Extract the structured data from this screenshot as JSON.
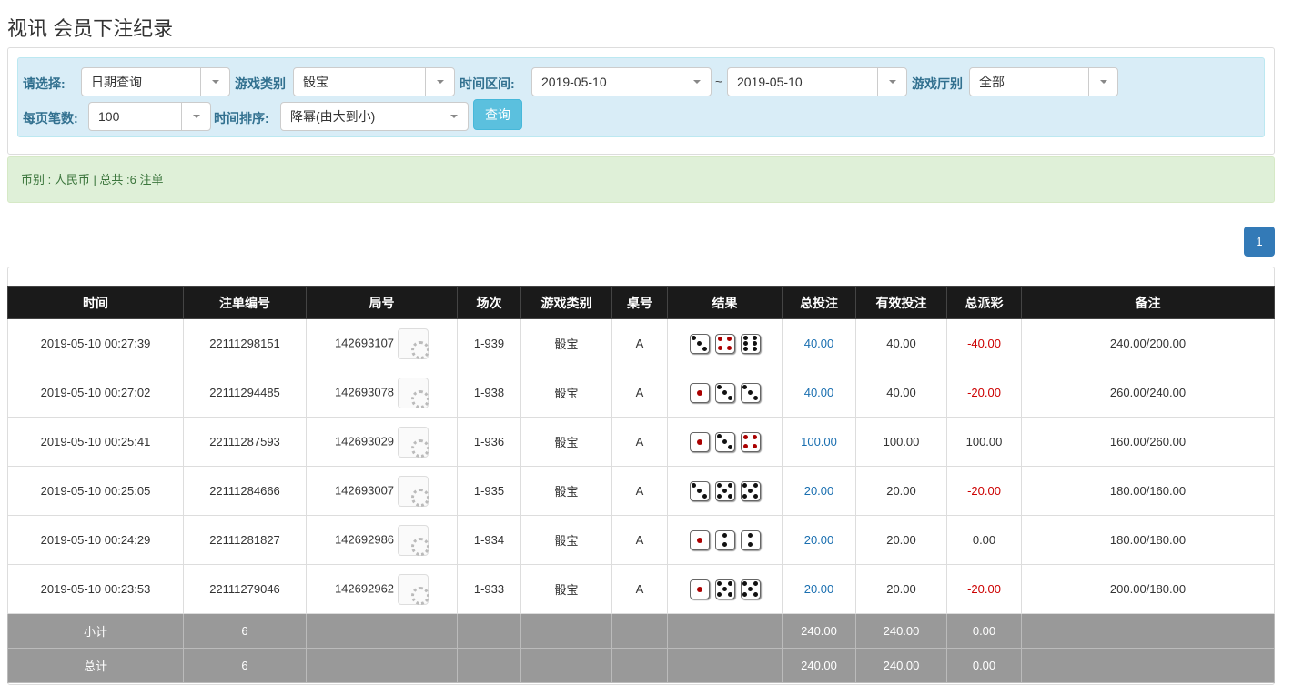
{
  "title": "视讯 会员下注纪录",
  "filters": {
    "select_label": "请选择:",
    "select_value": "日期查询",
    "game_label": "游戏类别",
    "game_value": "骰宝",
    "range_label": "时间区间:",
    "date_from": "2019-05-10",
    "tilde": "~",
    "date_to": "2019-05-10",
    "hall_label": "游戏厅别",
    "hall_value": "全部",
    "per_page_label": "每页笔数:",
    "per_page_value": "100",
    "sort_label": "时间排序:",
    "sort_value": "降幂(由大到小)",
    "query_button": "查询"
  },
  "summary": "币别 : 人民币 | 总共 :6 注单",
  "pagination": {
    "current": "1"
  },
  "colors": {
    "blue": "#1a6fb0",
    "red": "#cc0000"
  },
  "table": {
    "headers": [
      "时间",
      "注单编号",
      "局号",
      "场次",
      "游戏类别",
      "桌号",
      "结果",
      "总投注",
      "有效投注",
      "总派彩",
      "备注"
    ],
    "rows": [
      {
        "time": "2019-05-10 00:27:39",
        "bet_id": "22111298151",
        "round": "142693107",
        "session": "1-939",
        "game": "骰宝",
        "table": "A",
        "dice": [
          3,
          4,
          6
        ],
        "total": "40.00",
        "valid": "40.00",
        "payout": "-40.00",
        "note": "240.00/200.00"
      },
      {
        "time": "2019-05-10 00:27:02",
        "bet_id": "22111294485",
        "round": "142693078",
        "session": "1-938",
        "game": "骰宝",
        "table": "A",
        "dice": [
          1,
          3,
          3
        ],
        "total": "40.00",
        "valid": "40.00",
        "payout": "-20.00",
        "note": "260.00/240.00"
      },
      {
        "time": "2019-05-10 00:25:41",
        "bet_id": "22111287593",
        "round": "142693029",
        "session": "1-936",
        "game": "骰宝",
        "table": "A",
        "dice": [
          1,
          3,
          4
        ],
        "total": "100.00",
        "valid": "100.00",
        "payout": "100.00",
        "note": "160.00/260.00"
      },
      {
        "time": "2019-05-10 00:25:05",
        "bet_id": "22111284666",
        "round": "142693007",
        "session": "1-935",
        "game": "骰宝",
        "table": "A",
        "dice": [
          3,
          5,
          5
        ],
        "total": "20.00",
        "valid": "20.00",
        "payout": "-20.00",
        "note": "180.00/160.00"
      },
      {
        "time": "2019-05-10 00:24:29",
        "bet_id": "22111281827",
        "round": "142692986",
        "session": "1-934",
        "game": "骰宝",
        "table": "A",
        "dice": [
          1,
          2,
          2
        ],
        "total": "20.00",
        "valid": "20.00",
        "payout": "0.00",
        "note": "180.00/180.00"
      },
      {
        "time": "2019-05-10 00:23:53",
        "bet_id": "22111279046",
        "round": "142692962",
        "session": "1-933",
        "game": "骰宝",
        "table": "A",
        "dice": [
          1,
          5,
          5
        ],
        "total": "20.00",
        "valid": "20.00",
        "payout": "-20.00",
        "note": "200.00/180.00"
      }
    ],
    "subtotal": {
      "label": "小计",
      "count": "6",
      "total": "240.00",
      "valid": "240.00",
      "payout": "0.00"
    },
    "grand_total": {
      "label": "总计",
      "count": "6",
      "total": "240.00",
      "valid": "240.00",
      "payout": "0.00"
    }
  }
}
